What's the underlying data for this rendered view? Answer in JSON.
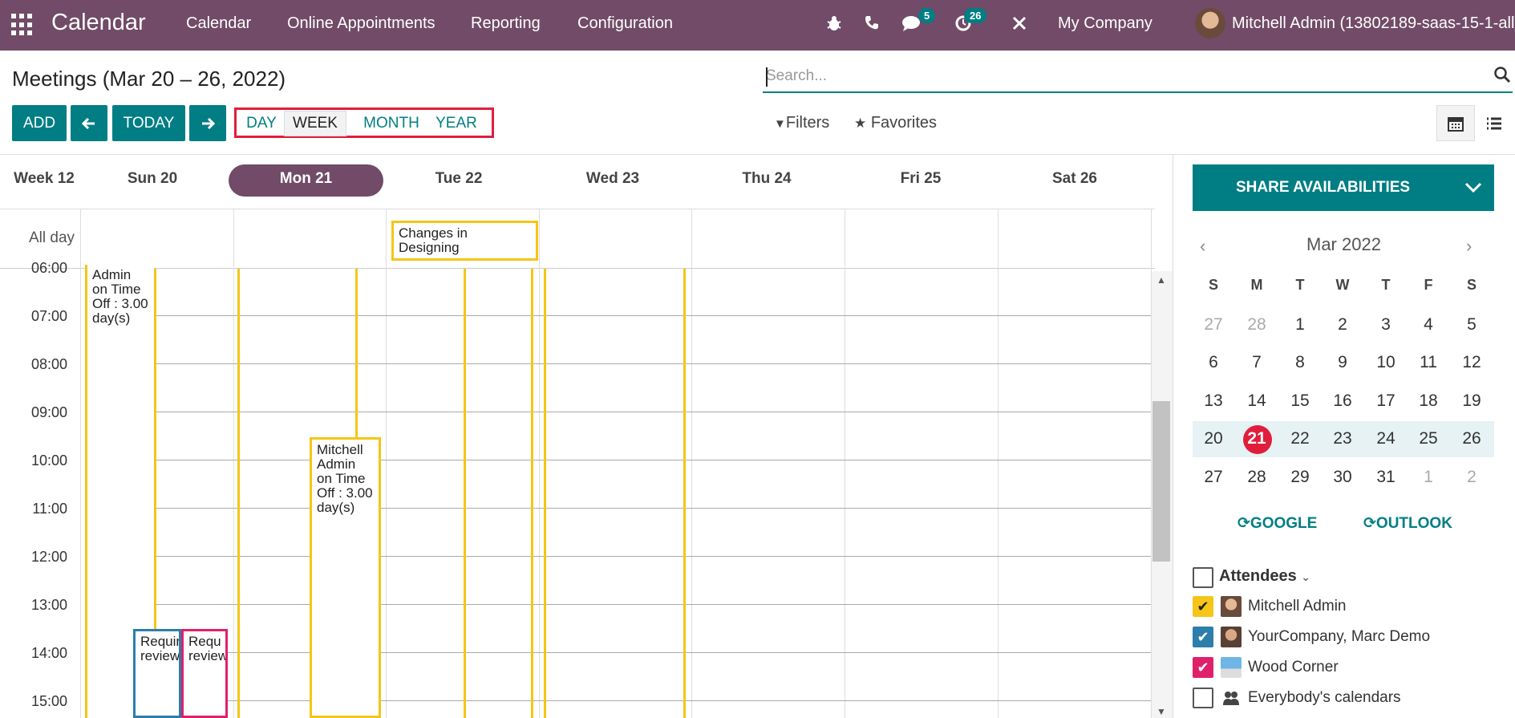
{
  "navbar": {
    "app_title": "Calendar",
    "menu": [
      "Calendar",
      "Online Appointments",
      "Reporting",
      "Configuration"
    ],
    "messages_badge": "5",
    "activities_badge": "26",
    "company": "My Company",
    "user": "Mitchell Admin (13802189-saas-15-1-all)",
    "icons": [
      "apps-grid-icon",
      "bug-icon",
      "phone-icon",
      "chat-icon",
      "clock-icon",
      "tools-icon"
    ]
  },
  "control_panel": {
    "title": "Meetings (Mar 20 – 26, 2022)",
    "search_placeholder": "Search...",
    "add": "ADD",
    "today": "TODAY",
    "ranges": [
      "DAY",
      "WEEK",
      "MONTH",
      "YEAR"
    ],
    "active_range": "WEEK",
    "filters": "Filters",
    "favorites": "Favorites"
  },
  "calendar": {
    "week_label": "Week 12",
    "days": [
      "Sun 20",
      "Mon 21",
      "Tue 22",
      "Wed 23",
      "Thu 24",
      "Fri 25",
      "Sat 26"
    ],
    "today": "Mon 21",
    "all_day_label": "All day",
    "all_day_event": "Changes in Designing",
    "hours": [
      "06:00",
      "07:00",
      "08:00",
      "09:00",
      "10:00",
      "11:00",
      "12:00",
      "13:00",
      "14:00",
      "15:00"
    ],
    "events": [
      {
        "text": "Admin on Time Off : 3.00 day(s)",
        "day": "Sun 20"
      },
      {
        "text": "Mitchell Admin on Time Off : 3.00 day(s)",
        "day": "Mon 21"
      },
      {
        "text": "Requir review",
        "day": "Sun 20"
      },
      {
        "text": "Requ review",
        "day": "Sun 20"
      }
    ]
  },
  "sidebar": {
    "share": "SHARE AVAILABILITIES",
    "month": "Mar 2022",
    "dow": [
      "S",
      "M",
      "T",
      "W",
      "T",
      "F",
      "S"
    ],
    "weeks": [
      [
        "27",
        "28",
        "1",
        "2",
        "3",
        "4",
        "5"
      ],
      [
        "6",
        "7",
        "8",
        "9",
        "10",
        "11",
        "12"
      ],
      [
        "13",
        "14",
        "15",
        "16",
        "17",
        "18",
        "19"
      ],
      [
        "20",
        "21",
        "22",
        "23",
        "24",
        "25",
        "26"
      ],
      [
        "27",
        "28",
        "29",
        "30",
        "31",
        "1",
        "2"
      ]
    ],
    "google": "GOOGLE",
    "outlook": "OUTLOOK",
    "attendees_title": "Attendees",
    "attendees": [
      {
        "name": "Mitchell Admin",
        "color": "#f5c518",
        "checked": true
      },
      {
        "name": "YourCompany, Marc Demo",
        "color": "#2c7eab",
        "checked": true
      },
      {
        "name": "Wood Corner",
        "color": "#e0206b",
        "checked": true
      },
      {
        "name": "Everybody's calendars",
        "color": "#ffffff",
        "checked": false
      }
    ]
  },
  "colors": {
    "brand": "#714b67",
    "primary": "#017e84",
    "today": "#e01e3c"
  }
}
